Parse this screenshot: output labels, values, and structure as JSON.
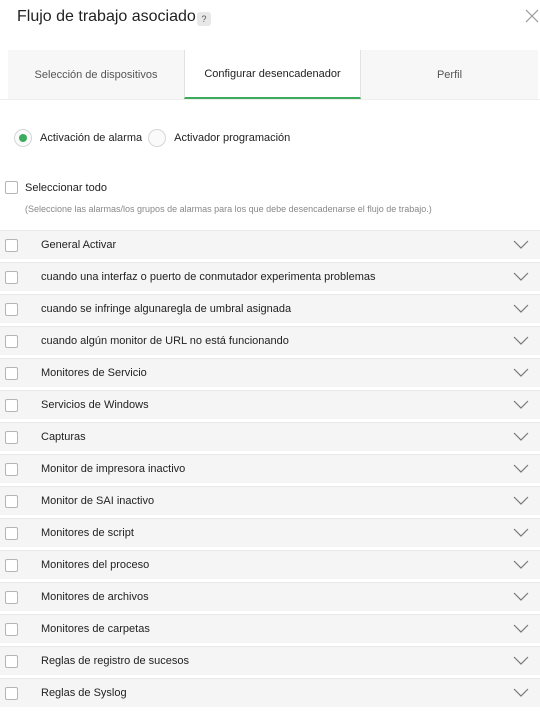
{
  "header": {
    "title": "Flujo de trabajo asociado",
    "help_glyph": "?",
    "icons": [
      "help-icon",
      "close-icon"
    ]
  },
  "tabs": [
    {
      "label": "Selección de dispositivos",
      "active": false
    },
    {
      "label": "Configurar desencadenador",
      "active": true
    },
    {
      "label": "Perfil",
      "active": false
    }
  ],
  "trigger": {
    "options": [
      {
        "label": "Activación de alarma",
        "selected": true
      },
      {
        "label": "Activador programación",
        "selected": false
      }
    ]
  },
  "select_all": {
    "label": "Seleccionar todo",
    "checked": false,
    "hint": "(Seleccione las alarmas/los grupos de alarmas para los que debe desencadenarse el flujo de trabajo.)"
  },
  "alarm_groups": [
    "General Activar",
    "cuando una interfaz o puerto de conmutador experimenta problemas",
    "cuando se infringe algunaregla de umbral asignada",
    "cuando algún monitor de URL no está funcionando",
    "Monitores de Servicio",
    "Servicios de Windows",
    "Capturas",
    "Monitor de impresora inactivo",
    "Monitor de SAI inactivo",
    "Monitores de script",
    "Monitores del proceso",
    "Monitores de archivos",
    "Monitores de carpetas",
    "Reglas de registro de sucesos",
    "Reglas de Syslog"
  ],
  "colors": {
    "accent_green": "#3cab5e",
    "row_bg": "#f5f5f5",
    "tab_bar_bg": "#f7f7f7"
  }
}
